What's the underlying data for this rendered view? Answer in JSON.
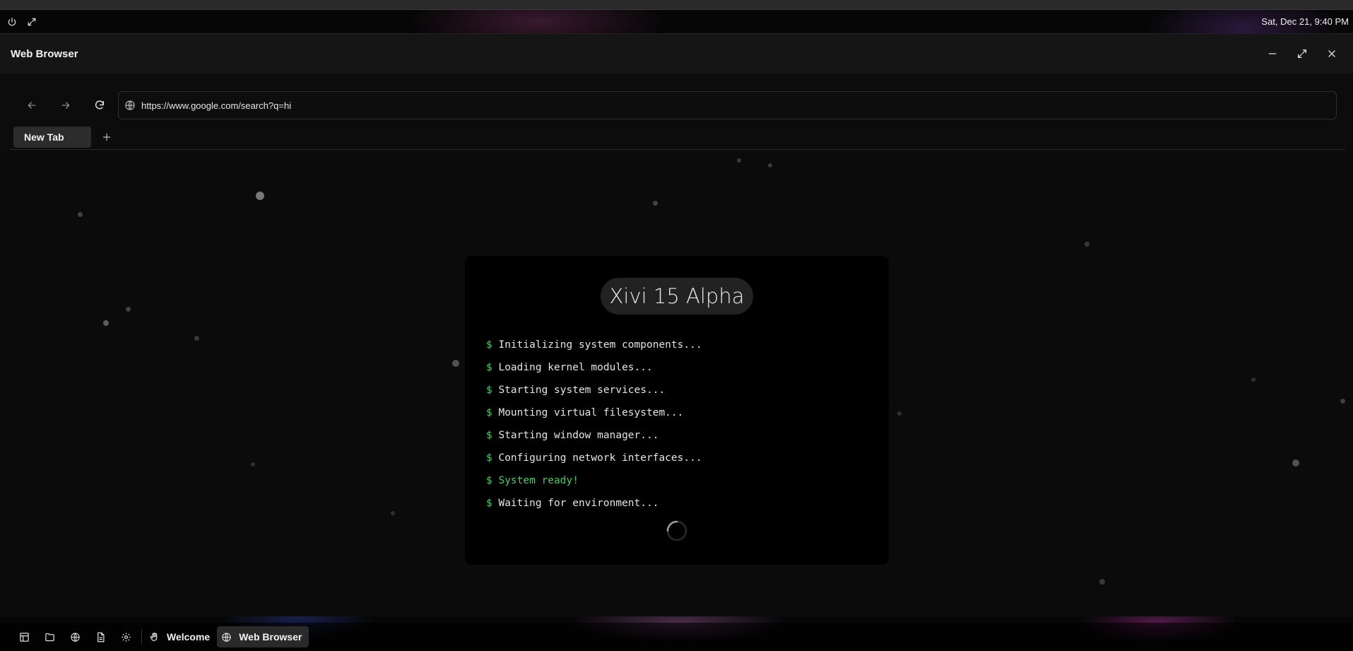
{
  "system": {
    "clock": "Sat, Dec 21, 9:40 PM",
    "power_icon": "power-icon",
    "fullscreen_icon": "expand-icon"
  },
  "window": {
    "title": "Web Browser",
    "controls": [
      "minimize-icon",
      "maximize-icon",
      "close-icon"
    ]
  },
  "browser": {
    "url": "https://www.google.com/search?q=hi",
    "nav_icons": [
      "back-arrow-icon",
      "forward-arrow-icon",
      "reload-icon",
      "globe-icon"
    ],
    "tabs": [
      {
        "label": "New Tab",
        "active": true
      }
    ],
    "add_tab_icon": "plus-icon"
  },
  "boot_screen": {
    "title": "Xivi 15 Alpha",
    "prompt": "$",
    "lines": [
      {
        "text": "Initializing system components...",
        "status": "normal"
      },
      {
        "text": "Loading kernel modules...",
        "status": "normal"
      },
      {
        "text": "Starting system services...",
        "status": "normal"
      },
      {
        "text": "Mounting virtual filesystem...",
        "status": "normal"
      },
      {
        "text": "Starting window manager...",
        "status": "normal"
      },
      {
        "text": "Configuring network interfaces...",
        "status": "normal"
      },
      {
        "text": "System ready!",
        "status": "success"
      },
      {
        "text": "Waiting for environment...",
        "status": "normal"
      }
    ],
    "success_color": "#3ecf62"
  },
  "taskbar": {
    "launcher_icons": [
      "dashboard-icon",
      "folder-icon",
      "globe-icon",
      "document-icon",
      "settings-gear-icon"
    ],
    "apps": [
      {
        "label": "Welcome",
        "icon": "hand-wave-icon",
        "active": false
      },
      {
        "label": "Web Browser",
        "icon": "globe-icon",
        "active": true
      }
    ]
  }
}
